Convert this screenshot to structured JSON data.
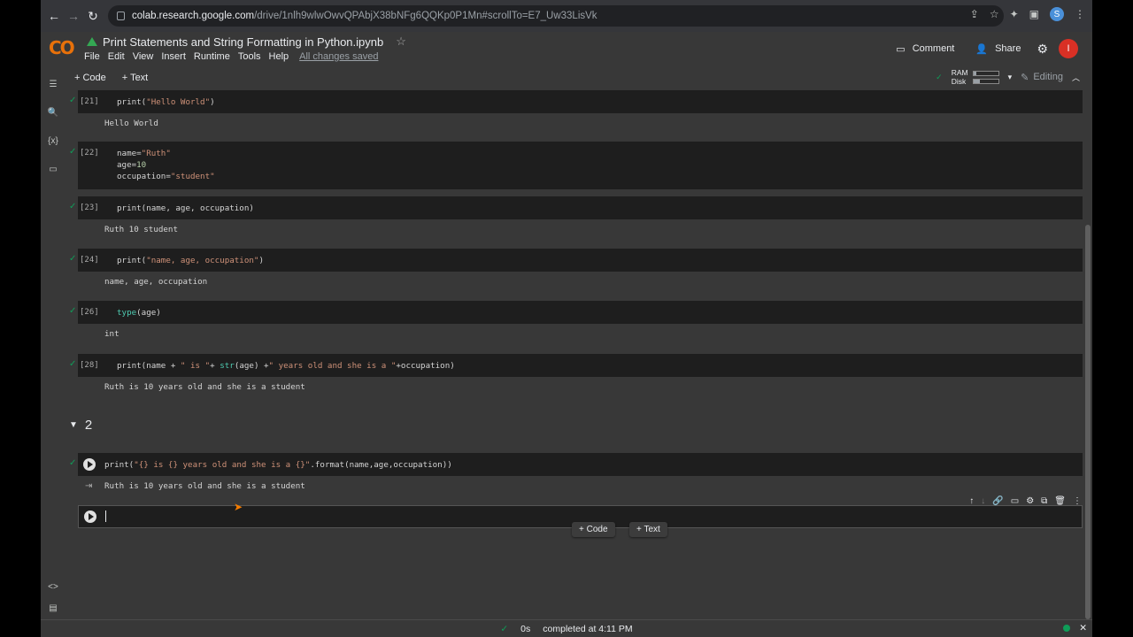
{
  "browser": {
    "url_host": "colab.research.google.com",
    "url_path": "/drive/1nlh9wlwOwvQPAbjX38bNFg6QQKp0P1Mn#scrollTo=E7_Uw33LisVk",
    "ext_avatar_letter": "S"
  },
  "header": {
    "logo_text": "CO",
    "title": "Print Statements and String Formatting in Python.ipynb",
    "menu": [
      "File",
      "Edit",
      "View",
      "Insert",
      "Runtime",
      "Tools",
      "Help"
    ],
    "saved_status": "All changes saved",
    "comment_label": "Comment",
    "share_label": "Share",
    "user_initial": "I"
  },
  "toolbar": {
    "add_code": "+ Code",
    "add_text": "+ Text",
    "ram_label": "RAM",
    "disk_label": "Disk",
    "ram_usage": 0.12,
    "disk_usage": 0.25,
    "editing_label": "Editing"
  },
  "cells": [
    {
      "count": "[21]",
      "code_lines": [
        "print(\"Hello World\")"
      ],
      "output": "Hello World"
    },
    {
      "count": "[22]",
      "code_lines": [
        "name=\"Ruth\"",
        "age=10",
        "occupation=\"student\""
      ],
      "output": ""
    },
    {
      "count": "[23]",
      "code_lines": [
        "print(name, age, occupation)"
      ],
      "output": "Ruth 10 student"
    },
    {
      "count": "[24]",
      "code_lines": [
        "print(\"name, age, occupation\")"
      ],
      "output": "name, age, occupation"
    },
    {
      "count": "[26]",
      "code_lines": [
        "type(age)"
      ],
      "output": "int"
    },
    {
      "count": "[28]",
      "code_lines": [
        "print(name + \" is \"+ str(age) +\" years old and she is a \"+occupation)"
      ],
      "output": "Ruth is 10 years old and she is a student"
    },
    {
      "count": "",
      "code_lines": [
        "print(\"{} is {} years old and she is a {}\".format(name,age,occupation))"
      ],
      "output": "Ruth is 10 years old and she is a student"
    }
  ],
  "section": {
    "heading": "2"
  },
  "add_buttons": {
    "code": "+ Code",
    "text": "+ Text"
  },
  "status_bar": {
    "duration": "0s",
    "completed": "completed at 4:11 PM"
  }
}
